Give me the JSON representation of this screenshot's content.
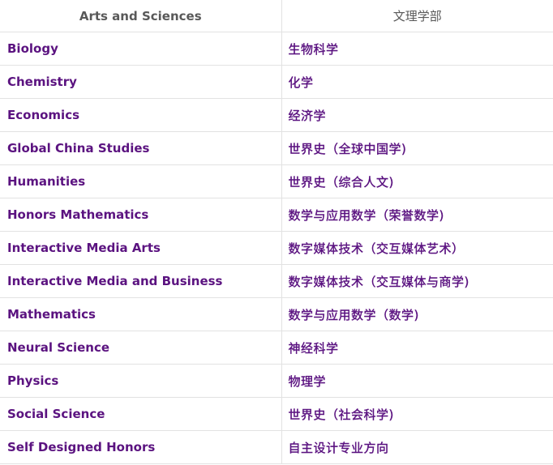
{
  "table": {
    "headers": [
      "Arts and Sciences",
      "文理学部"
    ],
    "rows": [
      [
        "Biology",
        "生物科学"
      ],
      [
        "Chemistry",
        "化学"
      ],
      [
        "Economics",
        "经济学"
      ],
      [
        "Global China Studies",
        "世界史（全球中国学)"
      ],
      [
        "Humanities",
        "世界史（综合人文)"
      ],
      [
        "Honors Mathematics",
        "数学与应用数学（荣誉数学)"
      ],
      [
        "Interactive Media Arts",
        "数字媒体技术（交互媒体艺术）"
      ],
      [
        "Interactive Media and Business",
        "数字媒体技术（交互媒体与商学)"
      ],
      [
        "Mathematics",
        "数学与应用数学（数学)"
      ],
      [
        "Neural Science",
        "神经科学"
      ],
      [
        "Physics",
        "物理学"
      ],
      [
        "Social Science",
        "世界史（社会科学)"
      ],
      [
        "Self Designed Honors",
        "自主设计专业方向"
      ]
    ]
  },
  "colors": {
    "header_text": "#595959",
    "row_text": "#5b1380",
    "border": "#e2e2e2"
  }
}
